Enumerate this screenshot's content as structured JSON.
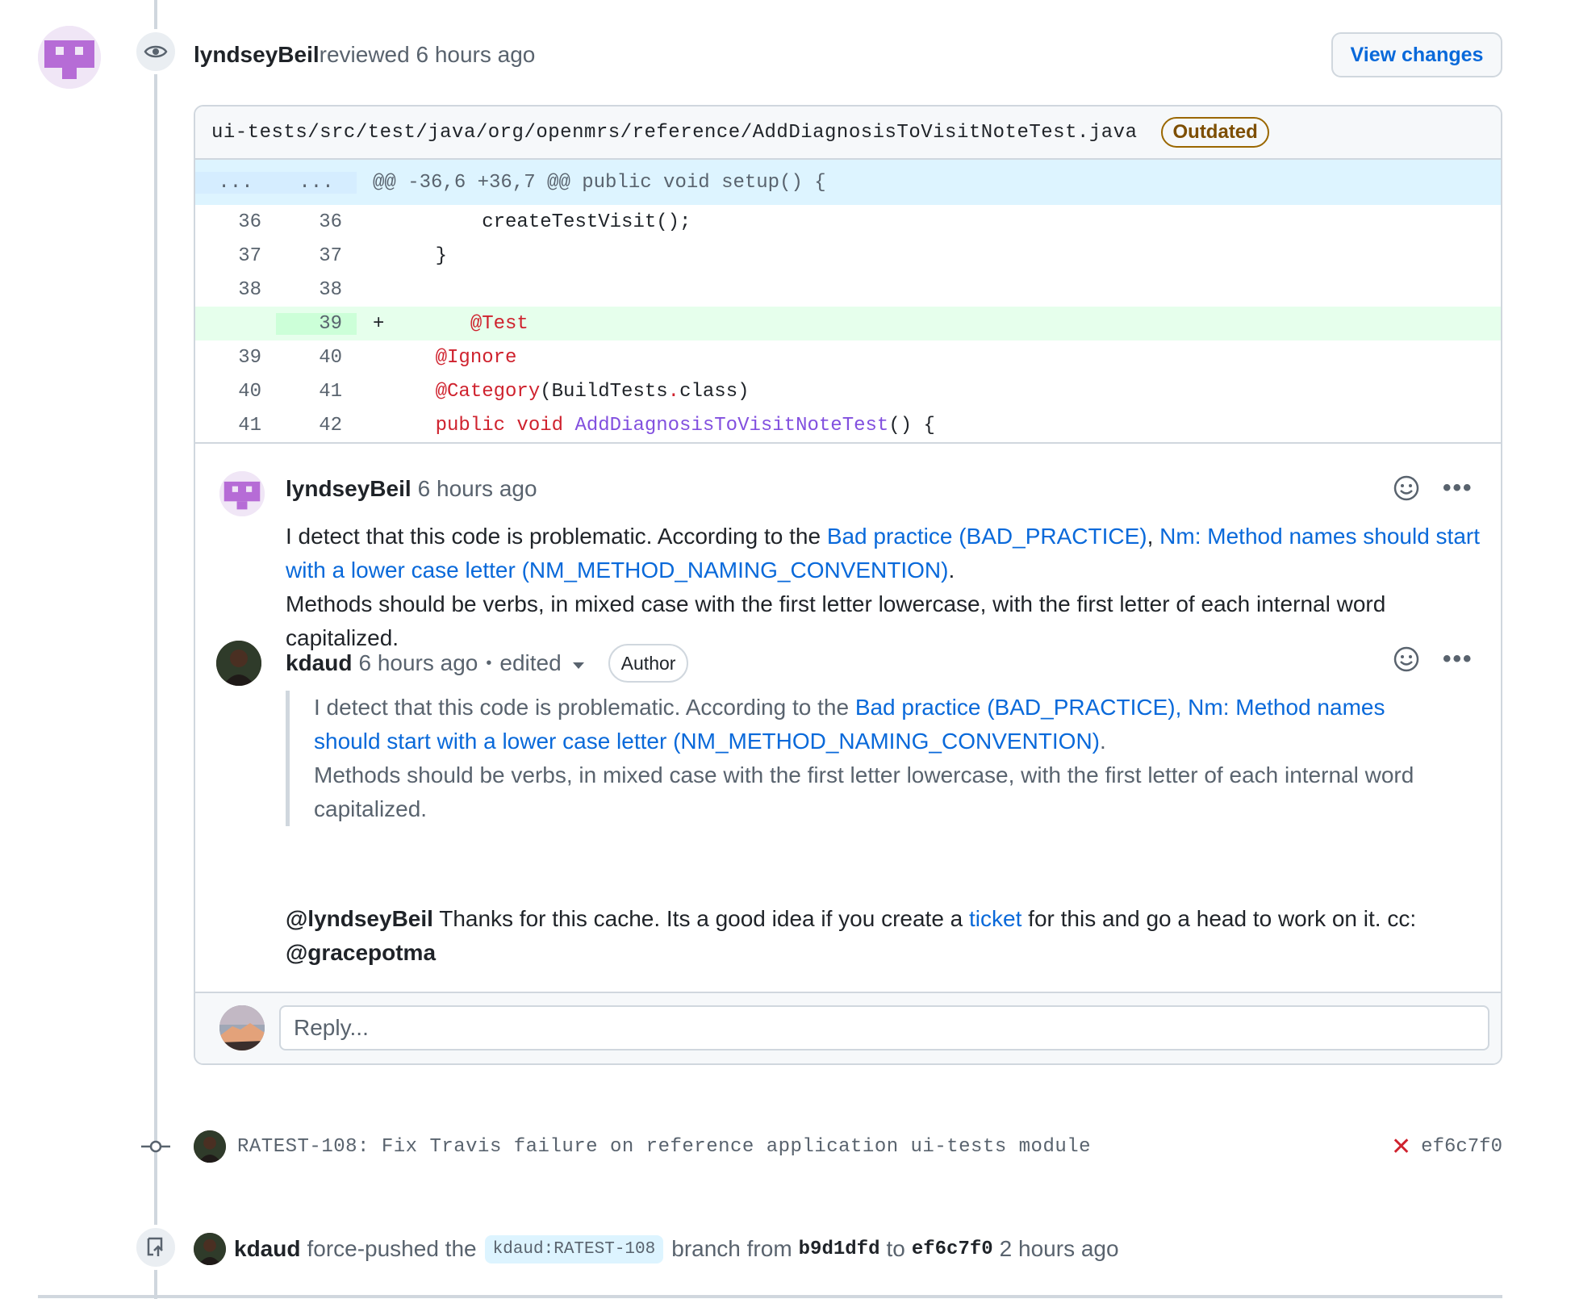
{
  "review": {
    "user": "lyndseyBeil",
    "action": "reviewed",
    "time": "6 hours ago",
    "view_changes_label": "View changes"
  },
  "file": {
    "path": "ui-tests/src/test/java/org/openmrs/reference/AddDiagnosisToVisitNoteTest.java",
    "badge": "Outdated"
  },
  "diff": {
    "hunk_left": "...",
    "hunk_right": "...",
    "hunk_header": "@@ -36,6 +36,7 @@ public void setup() {",
    "lines": [
      {
        "old": "36",
        "new": "36",
        "marker": "",
        "code": "        createTestVisit();"
      },
      {
        "old": "37",
        "new": "37",
        "marker": "",
        "code": "    }"
      },
      {
        "old": "38",
        "new": "38",
        "marker": "",
        "code": ""
      },
      {
        "old": "",
        "new": "39",
        "marker": "+",
        "code": "      @Test"
      },
      {
        "old": "39",
        "new": "40",
        "marker": "",
        "code": "    @Ignore"
      },
      {
        "old": "40",
        "new": "41",
        "marker": "",
        "code_a": "    @Category",
        "code_b": "(BuildTests",
        "code_c": ".",
        "code_d": "class)"
      },
      {
        "old": "41",
        "new": "42",
        "marker": "",
        "code_a": "    public void ",
        "code_b": "AddDiagnosisToVisitNoteTest",
        "code_c": "() {"
      }
    ]
  },
  "comment1": {
    "user": "lyndseyBeil",
    "time": "6 hours ago",
    "text_a": "I detect that this code is problematic. According to the ",
    "link_a": "Bad practice (BAD_PRACTICE)",
    "sep": ", ",
    "link_b": "Nm: Method names should start with a lower case letter (NM_METHOD_NAMING_CONVENTION)",
    "end": ".",
    "text_b": "Methods should be verbs, in mixed case with the first letter lowercase, with the first letter of each internal word capitalized."
  },
  "comment2": {
    "user": "kdaud",
    "time": "6 hours ago",
    "dot": "•",
    "edited": "edited",
    "badge": "Author",
    "quote_text_a": "I detect that this code is problematic. According to the ",
    "quote_link": "Bad practice (BAD_PRACTICE), Nm: Method names should start with a lower case letter (NM_METHOD_NAMING_CONVENTION)",
    "quote_end": ".",
    "quote_text_b": "Methods should be verbs, in mixed case with the first letter lowercase, with the first letter of each internal word capitalized.",
    "mention1": "@lyndseyBeil",
    "reply_a": " Thanks for this cache. Its a good idea if you create a ",
    "reply_link": "ticket",
    "reply_b": " for this and go a head to work on it. cc:",
    "mention2": "@gracepotma"
  },
  "reply": {
    "placeholder": "Reply..."
  },
  "commit": {
    "message": "RATEST-108: Fix Travis failure on reference application ui-tests module",
    "status": "✕",
    "sha": "ef6c7f0"
  },
  "push": {
    "user": "kdaud",
    "text_a": "force-pushed the",
    "branch": "kdaud:RATEST-108",
    "text_b": "branch from",
    "from_sha": "b9d1dfd",
    "text_c": "to",
    "to_sha": "ef6c7f0",
    "time": "2 hours ago"
  },
  "colors": {
    "link": "#0969da",
    "add_bg": "#e6ffec",
    "hunk_bg": "#ddf4ff",
    "outdated": "#9a6700",
    "fail": "#cf222e"
  }
}
